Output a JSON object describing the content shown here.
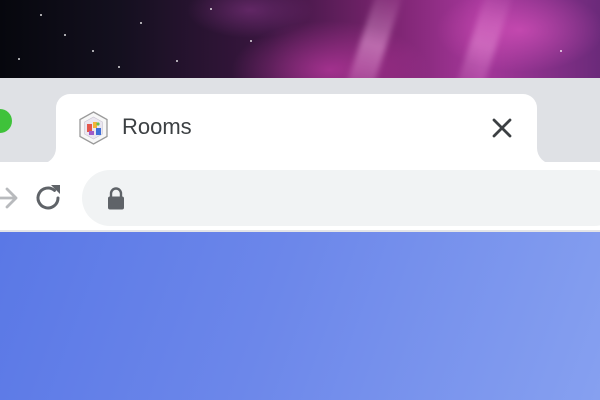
{
  "browser": {
    "tab": {
      "title": "Rooms",
      "favicon": "rooms-app-icon",
      "close_icon": "close-icon"
    },
    "toolbar": {
      "forward_icon": "arrow-right-icon",
      "reload_icon": "reload-icon",
      "omnibox": {
        "value": "",
        "secure_icon": "lock-icon"
      }
    }
  },
  "colors": {
    "tabstrip": "#dfe1e5",
    "tab_active": "#ffffff",
    "omnibox": "#f1f3f4",
    "content_gradient_start": "#5a78e6",
    "content_gradient_end": "#86a0f0",
    "window_zoom_button": "#3fc23a"
  }
}
